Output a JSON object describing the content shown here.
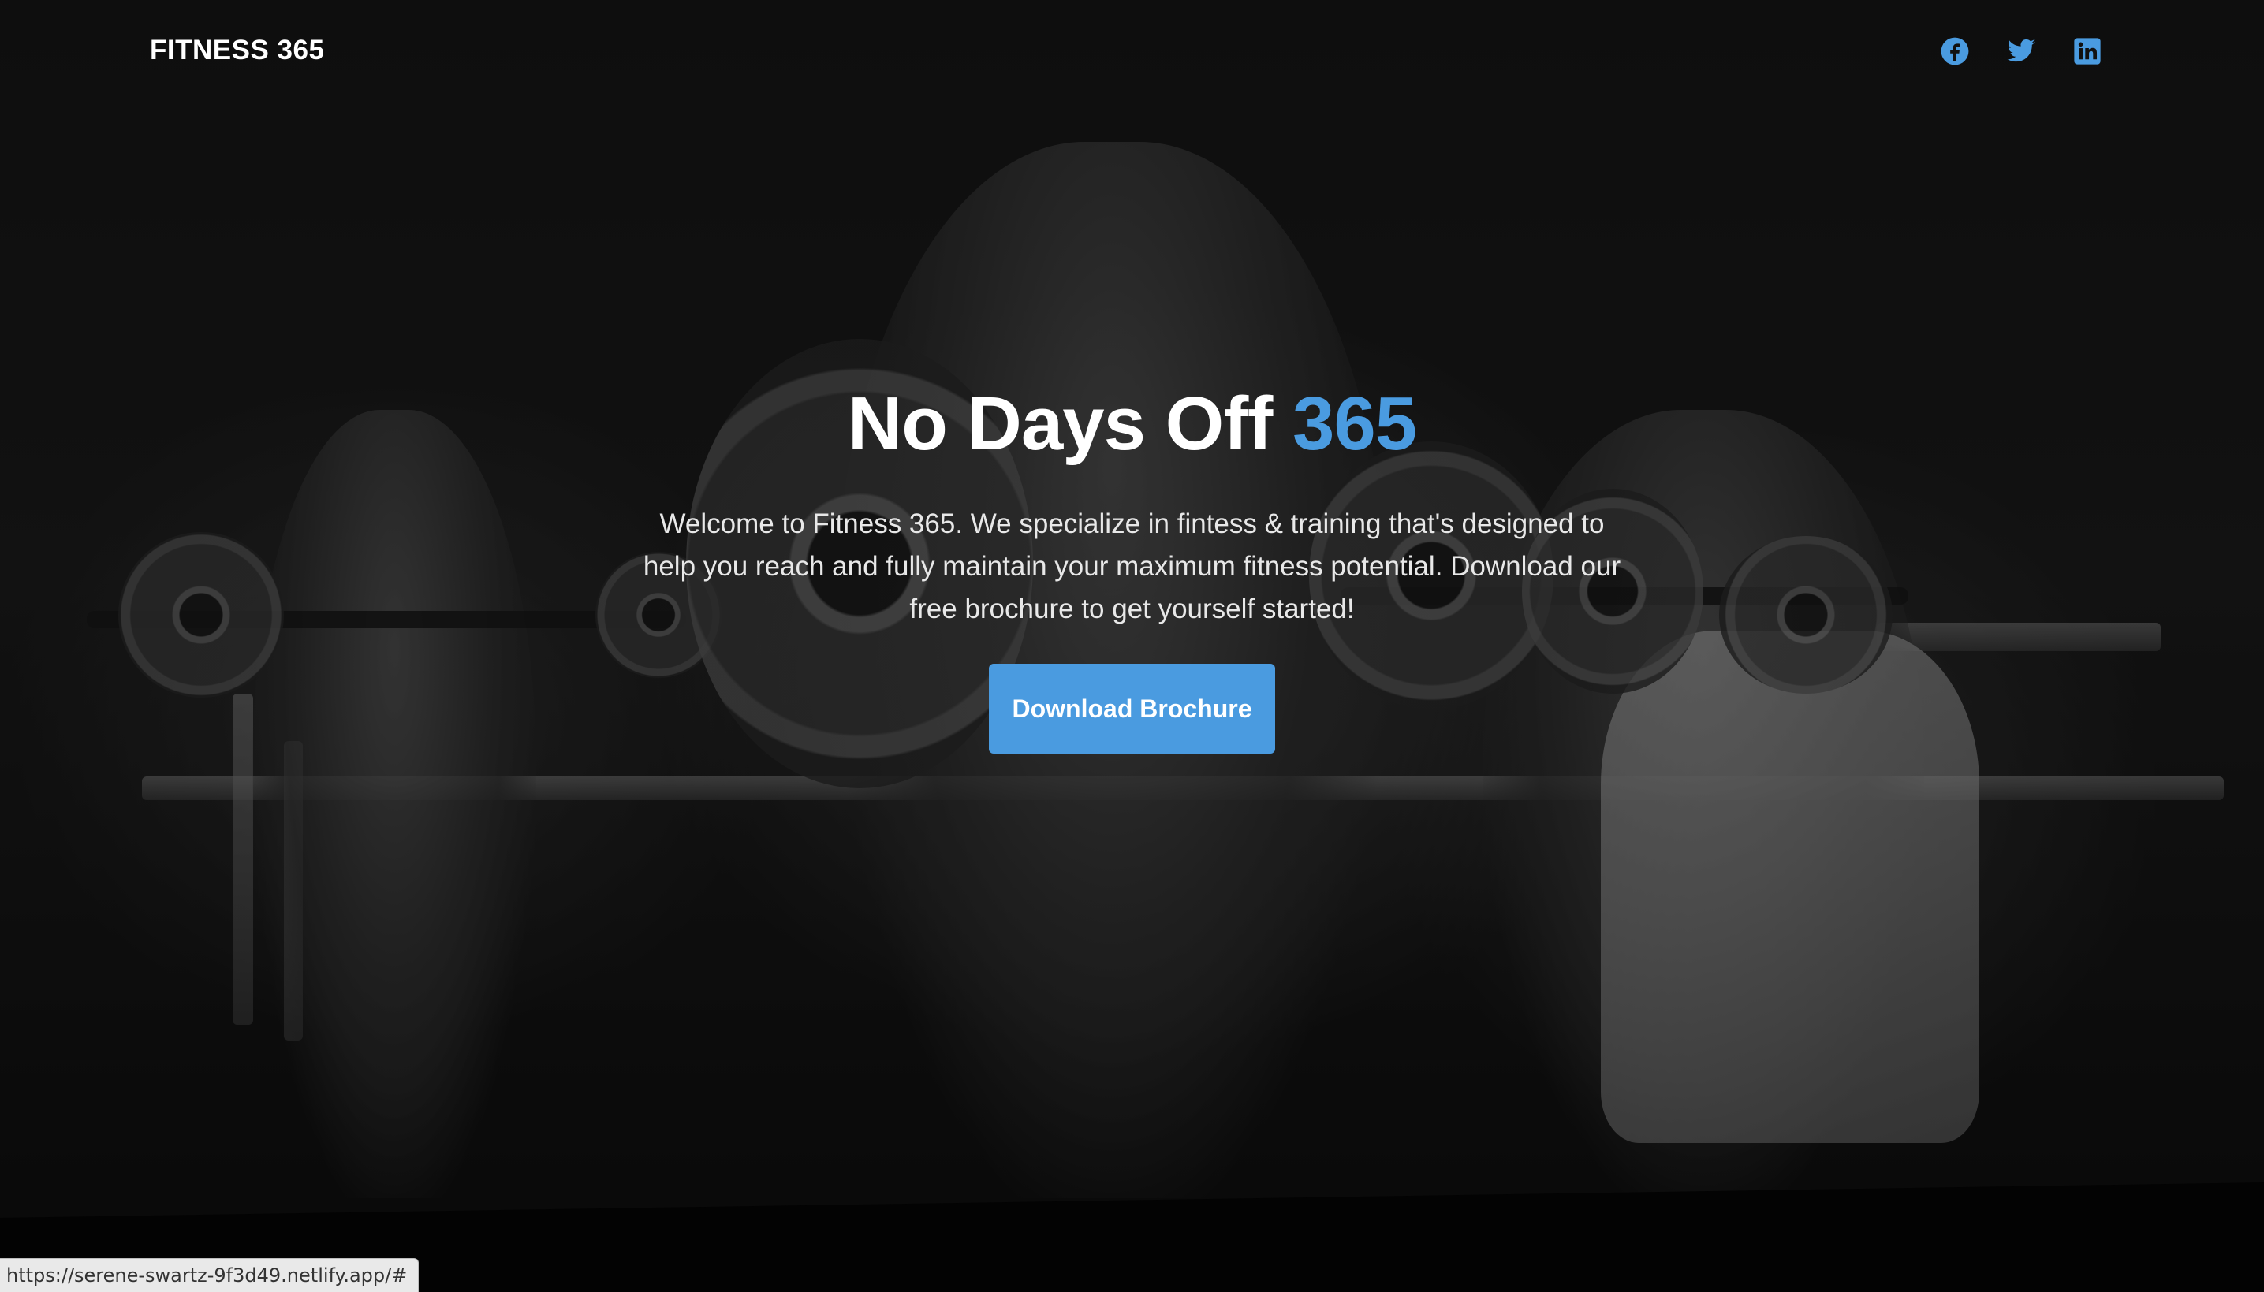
{
  "header": {
    "brand": "FITNESS 365"
  },
  "social": [
    {
      "name": "facebook-icon"
    },
    {
      "name": "twitter-icon"
    },
    {
      "name": "linkedin-icon"
    }
  ],
  "hero": {
    "title_main": "No Days Off ",
    "title_accent": "365",
    "intro": "Welcome to Fitness 365. We specialize in fintess & training that's designed to help you reach and fully maintain your maximum fitness potential. Download our free brochure to get yourself started!",
    "cta_label": "Download Brochure"
  },
  "status_bar": {
    "url": "https://serene-swartz-9f3d49.netlify.app/#"
  },
  "colors": {
    "accent": "#4a9be0",
    "text": "#ffffff",
    "background": "#050505"
  }
}
